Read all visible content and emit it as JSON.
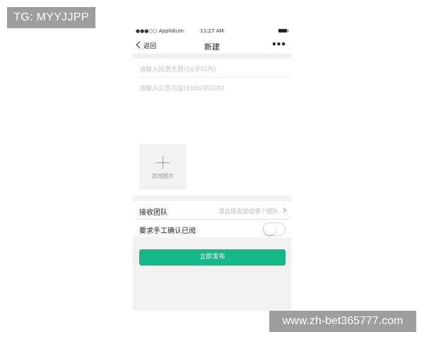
{
  "watermark_top": "TG: MYYJJPP",
  "watermark_bottom": "www.zh-bet365777.com",
  "status_bar": {
    "carrier": "●●●○○ Applidium",
    "time": "11:27 AM"
  },
  "nav": {
    "back_label": "返回",
    "title": "新建",
    "more_label": "•••"
  },
  "form": {
    "title_placeholder": "请输入投票主题(50字以内)",
    "content_placeholder": "请输入公告内容(1000字以内)",
    "add_image_label": "添加图片"
  },
  "settings": {
    "team_label": "接收团队",
    "team_placeholder": "请选择发送给哪个团队",
    "confirm_label": "要求手工确认已阅",
    "confirm_enabled": false
  },
  "publish_label": "立即发布",
  "colors": {
    "accent": "#12b886",
    "background": "#f0f0f1"
  }
}
